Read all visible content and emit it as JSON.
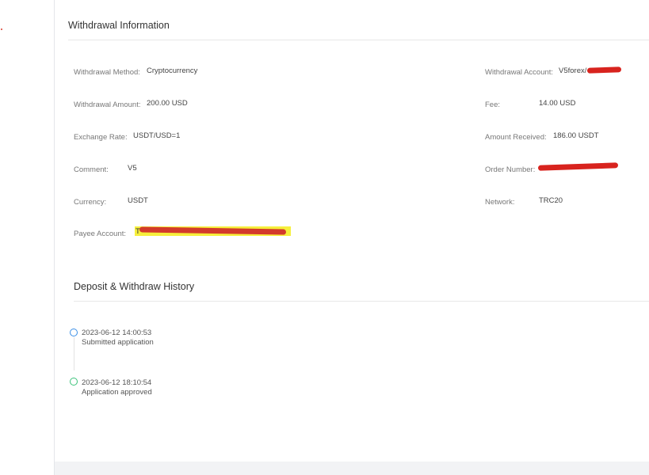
{
  "withdrawal_info": {
    "title": "Withdrawal Information",
    "left": [
      {
        "label": "Withdrawal Method:",
        "value": "Cryptocurrency"
      },
      {
        "label": "Withdrawal Amount:",
        "value": "200.00 USD"
      },
      {
        "label": "Exchange Rate:",
        "value": "USDT/USD=1"
      },
      {
        "label": "Comment:",
        "value": "V5"
      },
      {
        "label": "Currency:",
        "value": "USDT"
      },
      {
        "label": "Payee Account:",
        "value": "T"
      }
    ],
    "right": [
      {
        "label": "Withdrawal Account:",
        "value": "V5forex/"
      },
      {
        "label": "Fee:",
        "value": "14.00 USD"
      },
      {
        "label": "Amount Received:",
        "value": "186.00 USDT"
      },
      {
        "label": "Order Number:",
        "value": ""
      },
      {
        "label": "Network:",
        "value": "TRC20"
      }
    ]
  },
  "history": {
    "title": "Deposit & Withdraw History",
    "events": [
      {
        "time": "2023-06-12 14:00:53",
        "desc": "Submitted application",
        "status_color": "#3a8ee6"
      },
      {
        "time": "2023-06-12 18:10:54",
        "desc": "Application approved",
        "status_color": "#3bc27a"
      }
    ]
  }
}
